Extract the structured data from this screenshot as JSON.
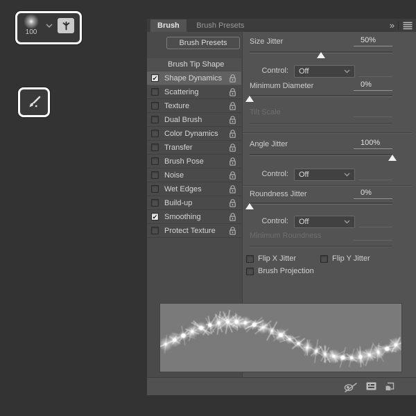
{
  "toolbar": {
    "brush_preview_size": "100"
  },
  "panel": {
    "header": {
      "collapse_glyph": "»"
    },
    "tabs": [
      {
        "label": "Brush",
        "active": true
      },
      {
        "label": "Brush Presets",
        "active": false
      }
    ],
    "left": {
      "presets_button": "Brush Presets",
      "tip_shape": "Brush Tip Shape",
      "items": [
        {
          "label": "Shape Dynamics",
          "checked": true,
          "selected": true
        },
        {
          "label": "Scattering",
          "checked": false,
          "selected": false
        },
        {
          "label": "Texture",
          "checked": false,
          "selected": false
        },
        {
          "label": "Dual Brush",
          "checked": false,
          "selected": false
        },
        {
          "label": "Color Dynamics",
          "checked": false,
          "selected": false
        },
        {
          "label": "Transfer",
          "checked": false,
          "selected": false
        },
        {
          "label": "Brush Pose",
          "checked": false,
          "selected": false
        },
        {
          "label": "Noise",
          "checked": false,
          "selected": false
        },
        {
          "label": "Wet Edges",
          "checked": false,
          "selected": false
        },
        {
          "label": "Build-up",
          "checked": false,
          "selected": false
        },
        {
          "label": "Smoothing",
          "checked": true,
          "selected": false
        },
        {
          "label": "Protect Texture",
          "checked": false,
          "selected": false
        }
      ]
    },
    "right": {
      "size_jitter": {
        "label": "Size Jitter",
        "value": "50%",
        "pct": 50
      },
      "size_control": {
        "label": "Control:",
        "value": "Off"
      },
      "min_diameter": {
        "label": "Minimum Diameter",
        "value": "0%",
        "pct": 0
      },
      "tilt_scale": {
        "label": "Tilt Scale",
        "disabled": true
      },
      "angle_jitter": {
        "label": "Angle Jitter",
        "value": "100%",
        "pct": 100
      },
      "angle_control": {
        "label": "Control:",
        "value": "Off"
      },
      "roundness_jitter": {
        "label": "Roundness Jitter",
        "value": "0%",
        "pct": 0
      },
      "roundness_control": {
        "label": "Control:",
        "value": "Off"
      },
      "min_roundness": {
        "label": "Minimum Roundness",
        "disabled": true
      },
      "flip_x": {
        "label": "Flip X Jitter",
        "checked": false
      },
      "flip_y": {
        "label": "Flip Y Jitter",
        "checked": false
      },
      "brush_projection": {
        "label": "Brush Projection",
        "checked": false
      }
    }
  },
  "icons": {
    "collapse": "double-chevron-right-icon",
    "menu": "panel-menu-icon",
    "brush_preview": "soft-round-brush-thumbnail",
    "toggle_panel": "toggle-brush-panel-icon",
    "brush_tool": "brush-tool-icon",
    "lock": "unlock-icon",
    "live_preview": "live-tip-preview-icon",
    "preset_manager": "preset-manager-icon",
    "new_brush": "create-new-brush-icon"
  },
  "colors": {
    "canvas_bg": "#333333",
    "panel_bg": "#535353",
    "left_col_bg": "#4a4a4a",
    "tab_bar_bg": "#3c3c3c",
    "selected_row_bg": "#616161",
    "text": "#d6d6d6",
    "disabled_text": "#6f6f6f",
    "preview_bg": "#7a7a7a",
    "highlight_border": "#ffffff"
  }
}
